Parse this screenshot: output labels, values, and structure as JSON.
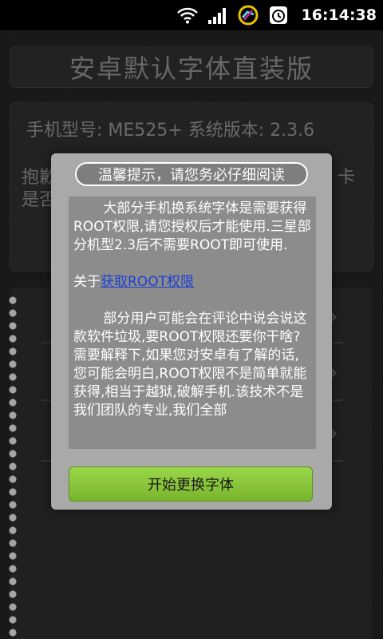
{
  "status_bar": {
    "time": "16:14:38",
    "icons": [
      "wifi-icon",
      "signal-icon",
      "app-notification-icon",
      "alarm-icon"
    ]
  },
  "header": {
    "title": "安卓默认字体直装版"
  },
  "info": {
    "device_line": "手机型号: ME525+  系统版本: 2.3.6",
    "notice_line1": "抱歉",
    "notice_line1_tail": "卡",
    "notice_line2": "是否"
  },
  "dialog": {
    "title": "温馨提示，请您务必仔细阅读",
    "paragraph1": "大部分手机换系统字体是需要获得ROOT权限,请您授权后才能使用.三星部分机型2.3后不需要ROOT即可使用.",
    "about_prefix": "关于",
    "about_link": "获取ROOT权限",
    "paragraph2": "部分用户可能会在评论中说会说这款软件垃圾,要ROOT权限还要你干啥?需要解释下,如果您对安卓有了解的话,您可能会明白,ROOT权限不是简单就能获得,相当于越狱,破解手机.该技术不是我们团队的专业,我们全部",
    "button_label": "开始更换字体"
  },
  "colors": {
    "accent_button": "#8cc63f",
    "link": "#1a3fd6"
  }
}
